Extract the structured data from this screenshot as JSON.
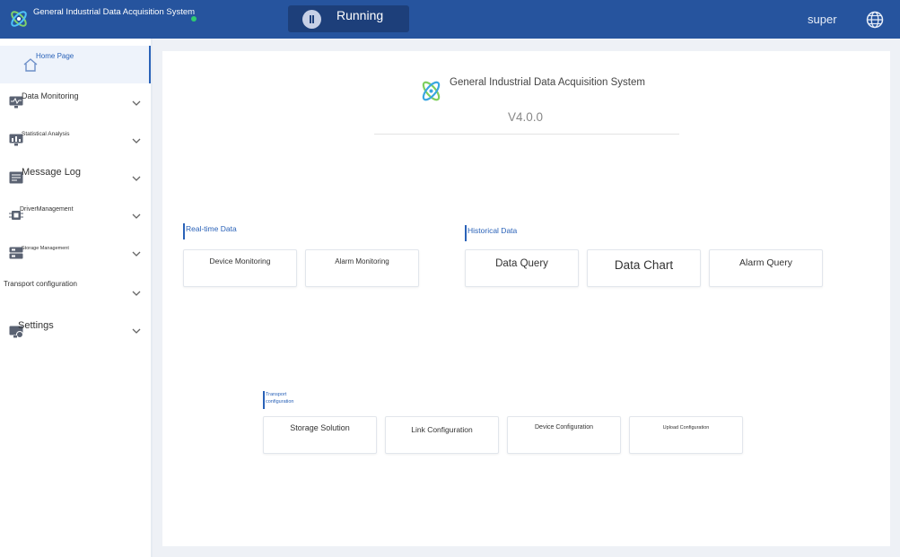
{
  "header": {
    "app_title": "General Industrial Data Acquisition System",
    "run_status": "Running",
    "user": "super",
    "icons": {
      "logo": "atom-logo-icon",
      "pause": "pause-icon",
      "language": "globe-icon"
    },
    "colors": {
      "bar": "#26549e",
      "status_dot": "#2ecc71",
      "accent": "#2a62b8"
    }
  },
  "sidebar": {
    "items": [
      {
        "label": "Home Page",
        "icon": "home-icon"
      },
      {
        "label": "Data Monitoring",
        "icon": "monitor-icon"
      },
      {
        "label": "Statistical Analysis",
        "icon": "chart-monitor-icon"
      },
      {
        "label": "Message Log",
        "icon": "log-icon"
      },
      {
        "label": "DriverManagement",
        "icon": "chip-icon"
      },
      {
        "label": "Storage Management",
        "icon": "storage-icon"
      },
      {
        "label": "Transport configuration",
        "icon": ""
      },
      {
        "label": "Settings",
        "icon": "settings-icon"
      }
    ]
  },
  "main": {
    "title": "General Industrial Data Acquisition System",
    "version": "V4.0.0",
    "sections": {
      "realtime": {
        "title": "Real-time Data",
        "tiles": [
          "Device Monitoring",
          "Alarm Monitoring"
        ]
      },
      "historical": {
        "title": "Historical Data",
        "tiles": [
          "Data Query",
          "Data Chart",
          "Alarm Query"
        ]
      },
      "transport": {
        "title_line1": "Transport",
        "title_line2": "configuration",
        "tiles": [
          "Storage Solution",
          "Link Configuration",
          "Device Configuration",
          "Upload Configuration"
        ]
      }
    }
  }
}
